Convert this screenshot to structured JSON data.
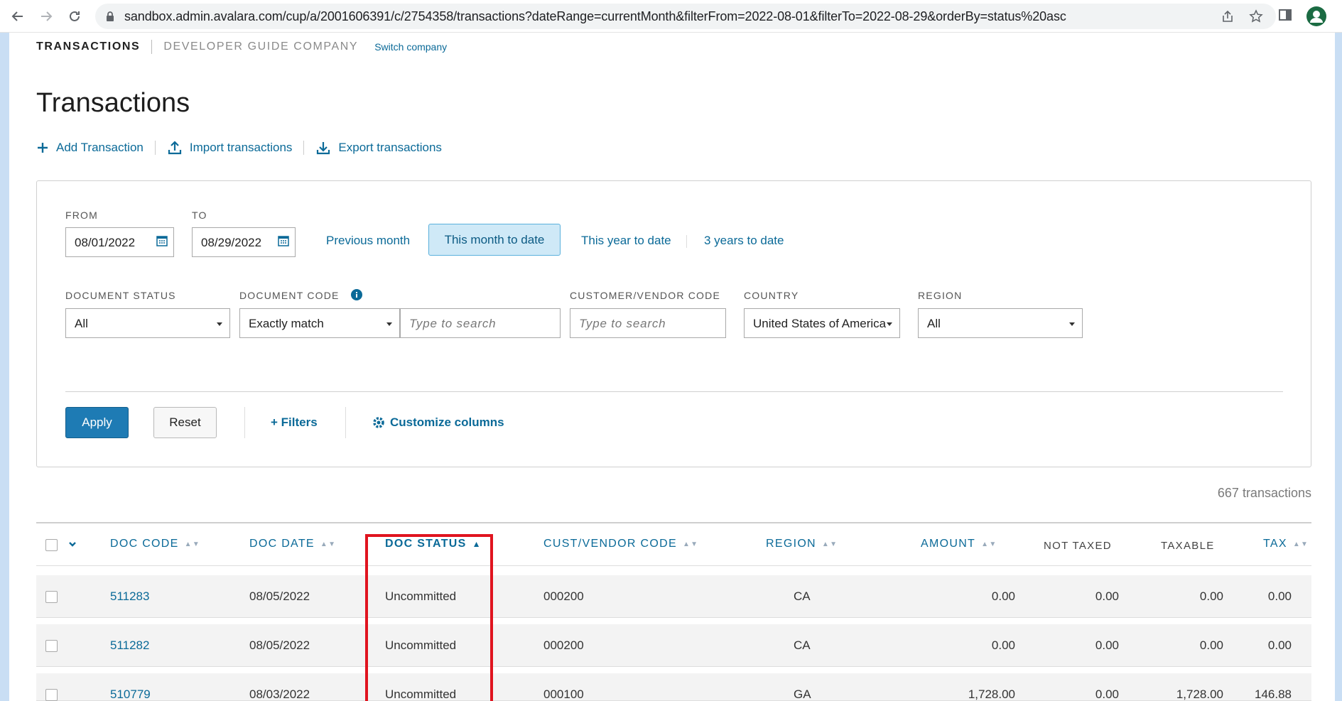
{
  "browser": {
    "url": "sandbox.admin.avalara.com/cup/a/2001606391/c/2754358/transactions?dateRange=currentMonth&filterFrom=2022-08-01&filterTo=2022-08-29&orderBy=status%20asc"
  },
  "breadcrumb": {
    "section": "TRANSACTIONS",
    "company": "DEVELOPER GUIDE COMPANY",
    "switch_label": "Switch company"
  },
  "page": {
    "title": "Transactions",
    "actions": {
      "add": "Add Transaction",
      "import": "Import transactions",
      "export": "Export transactions"
    }
  },
  "filters": {
    "from_label": "FROM",
    "from_value": "08/01/2022",
    "to_label": "TO",
    "to_value": "08/29/2022",
    "quick": {
      "previous_month": "Previous month",
      "this_month": "This month to date",
      "this_year": "This year to date",
      "three_years": "3 years to date"
    },
    "document_status": {
      "label": "DOCUMENT STATUS",
      "value": "All"
    },
    "document_code": {
      "label": "DOCUMENT CODE",
      "match_value": "Exactly match",
      "placeholder": "Type to search"
    },
    "customer_vendor_code": {
      "label": "CUSTOMER/VENDOR CODE",
      "placeholder": "Type to search"
    },
    "country": {
      "label": "COUNTRY",
      "value": "United States of America"
    },
    "region": {
      "label": "REGION",
      "value": "All"
    },
    "apply_label": "Apply",
    "reset_label": "Reset",
    "filters_label": "+ Filters",
    "customize_label": "Customize columns"
  },
  "results": {
    "count_text": "667 transactions"
  },
  "table": {
    "headers": {
      "doc_code": "DOC CODE",
      "doc_date": "DOC DATE",
      "doc_status": "DOC STATUS",
      "cust_vendor_code": "CUST/VENDOR CODE",
      "region": "REGION",
      "amount": "AMOUNT",
      "not_taxed": "NOT TAXED",
      "taxable": "TAXABLE",
      "tax": "TAX"
    },
    "rows": [
      {
        "doc_code": "511283",
        "doc_date": "08/05/2022",
        "doc_status": "Uncommitted",
        "cust_vendor_code": "000200",
        "region": "CA",
        "amount": "0.00",
        "not_taxed": "0.00",
        "taxable": "0.00",
        "tax": "0.00"
      },
      {
        "doc_code": "511282",
        "doc_date": "08/05/2022",
        "doc_status": "Uncommitted",
        "cust_vendor_code": "000200",
        "region": "CA",
        "amount": "0.00",
        "not_taxed": "0.00",
        "taxable": "0.00",
        "tax": "0.00"
      },
      {
        "doc_code": "510779",
        "doc_date": "08/03/2022",
        "doc_status": "Uncommitted",
        "cust_vendor_code": "000100",
        "region": "GA",
        "amount": "1,728.00",
        "not_taxed": "0.00",
        "taxable": "1,728.00",
        "tax": "146.88"
      }
    ]
  },
  "colors": {
    "accent": "#0b6a98",
    "apply_button": "#1e7bb4",
    "active_quick": "#cfe9f7",
    "highlight_box": "#e0141f"
  }
}
